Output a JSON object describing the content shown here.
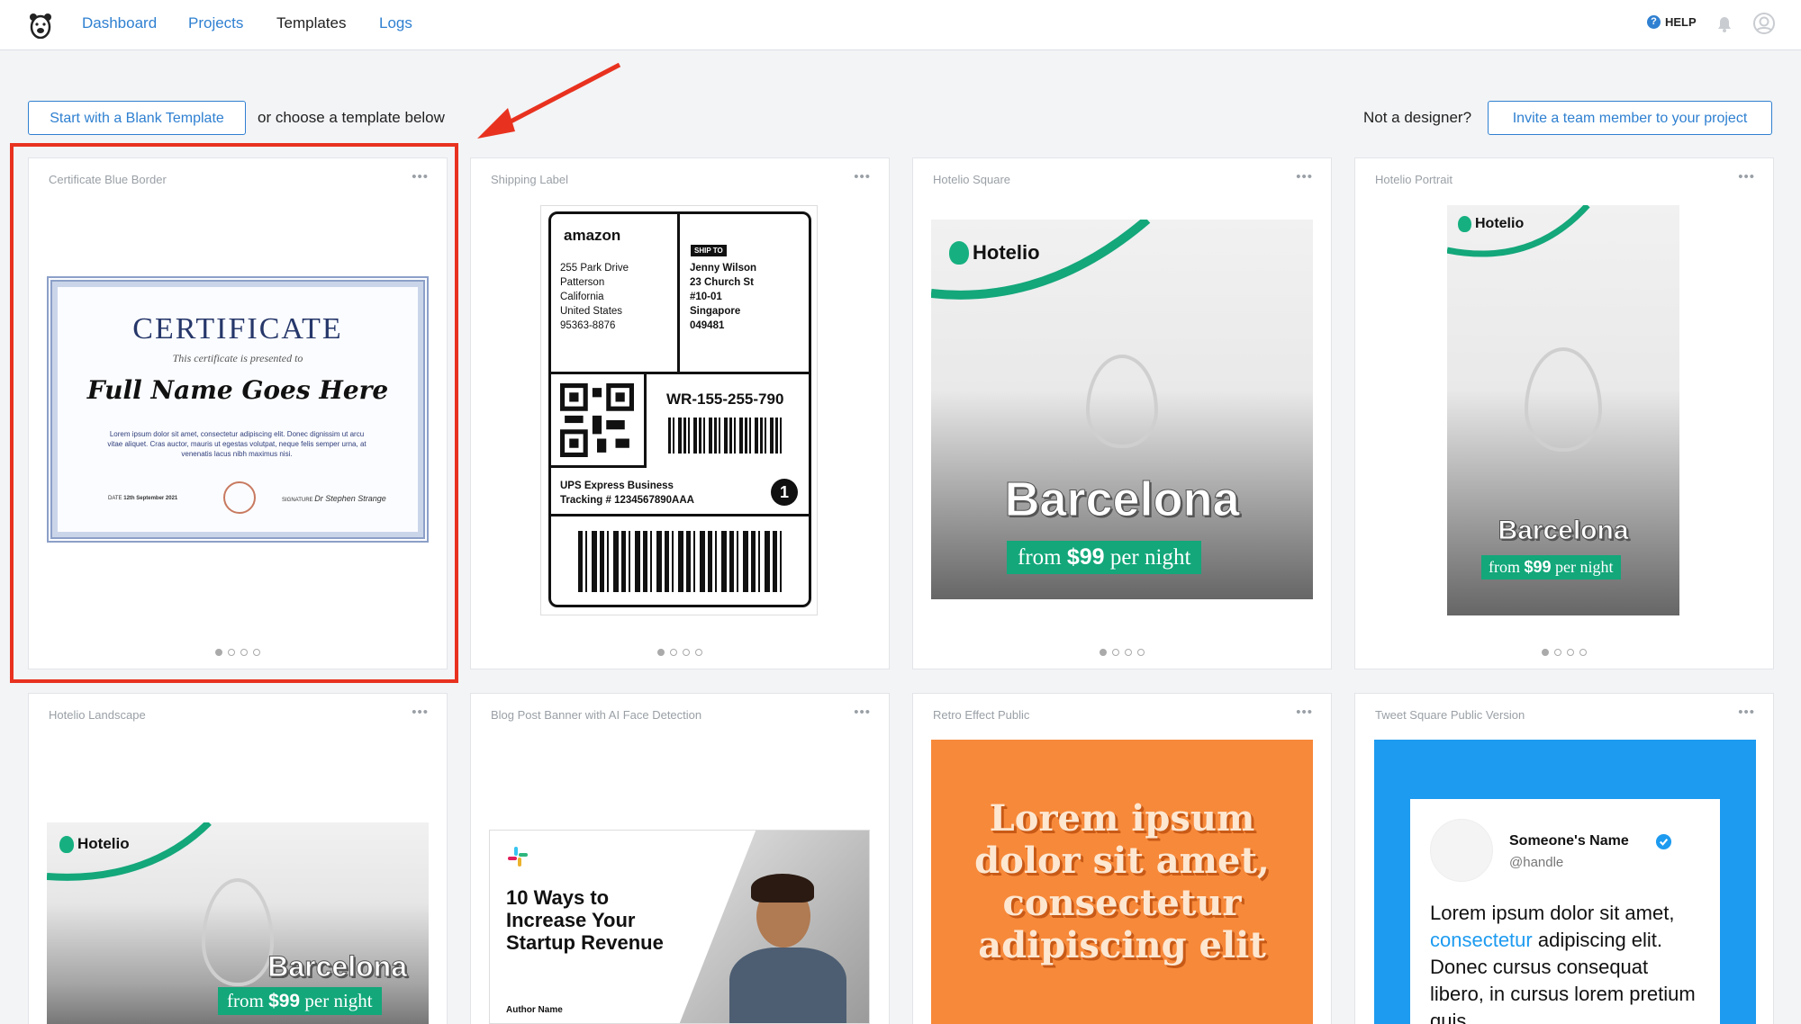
{
  "nav": {
    "items": [
      {
        "label": "Dashboard",
        "active": false
      },
      {
        "label": "Projects",
        "active": false
      },
      {
        "label": "Templates",
        "active": true
      },
      {
        "label": "Logs",
        "active": false
      }
    ],
    "help_label": "HELP",
    "help_icon": "?",
    "accent": "#2f80d1"
  },
  "toolbar": {
    "blank_button": "Start with a Blank Template",
    "choose_text": "or choose a template below",
    "not_designer": "Not a designer?",
    "invite_button": "Invite a team member to your project"
  },
  "cards": [
    {
      "title": "Certificate Blue Border",
      "menu": "•••",
      "pages": 4,
      "selected": true
    },
    {
      "title": "Shipping Label",
      "menu": "•••",
      "pages": 4
    },
    {
      "title": "Hotelio Square",
      "menu": "•••",
      "pages": 4
    },
    {
      "title": "Hotelio Portrait",
      "menu": "•••",
      "pages": 4
    },
    {
      "title": "Hotelio Landscape",
      "menu": "•••"
    },
    {
      "title": "Blog Post Banner with AI Face Detection",
      "menu": "•••"
    },
    {
      "title": "Retro Effect Public",
      "menu": "•••"
    },
    {
      "title": "Tweet Square Public Version",
      "menu": "•••"
    }
  ],
  "certificate": {
    "heading": "CERTIFICATE",
    "subheading": "This certificate is presented to",
    "name": "Full Name Goes Here",
    "body": "Lorem ipsum dolor sit amet, consectetur adipiscing elit. Donec dignissim ut arcu vitae aliquet. Cras auctor, mauris ut egestas volutpat, neque felis semper urna, at venenatis lacus nibh maximus nisi.",
    "date_label": "DATE",
    "date": "12th September 2021",
    "signature_label": "SIGNATURE",
    "signature": "Dr Stephen Strange"
  },
  "shipping": {
    "brand": "amazon",
    "from_lines": [
      "255 Park Drive",
      "Patterson",
      "California",
      "United States",
      "95363-8876"
    ],
    "ship_to_label": "SHIP TO",
    "to_lines": [
      "Jenny Wilson",
      "23 Church St",
      "#10-01",
      "Singapore",
      "049481"
    ],
    "tracking_code": "WR-155-255-790",
    "service_line1": "UPS Express Business",
    "service_line2": "Tracking # 1234567890AAA",
    "service_number": "1"
  },
  "hotelio": {
    "brand": "Hotelio",
    "city": "Barcelona",
    "price_from": "from",
    "price": "$99",
    "price_per": "per night",
    "accent": "#13a77a"
  },
  "blog": {
    "headline": "10 Ways to Increase Your Startup Revenue",
    "author": "Author Name"
  },
  "retro": {
    "text": "Lorem ipsum dolor sit amet, consectetur adipiscing elit",
    "bg": "#f7893a"
  },
  "tweet": {
    "name": "Someone's Name",
    "handle": "@handle",
    "text_a": "Lorem ipsum dolor sit amet, ",
    "text_link": "consectetur",
    "text_b": " adipiscing elit. Donec cursus consequat libero, in cursus lorem pretium quis.",
    "bg": "#1d9bf0"
  }
}
